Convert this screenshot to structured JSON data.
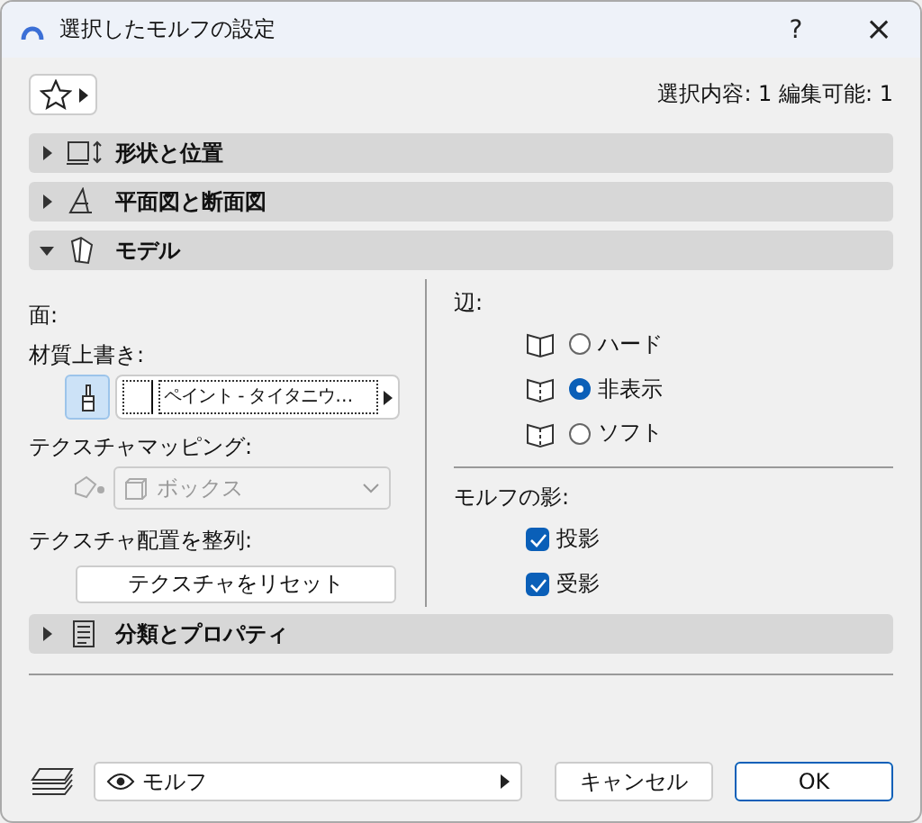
{
  "window": {
    "title": "選択したモルフの設定",
    "help": "?",
    "close": "×"
  },
  "selection_info": "選択内容: 1 編集可能: 1",
  "sections": [
    {
      "label": "形状と位置",
      "expanded": false,
      "kind": "shape"
    },
    {
      "label": "平面図と断面図",
      "expanded": false,
      "kind": "plan"
    },
    {
      "label": "モデル",
      "expanded": true,
      "kind": "model"
    }
  ],
  "model": {
    "face_label": "面:",
    "override_label": "材質上書き:",
    "override_on": true,
    "material": "ペイント - タイタニウ…",
    "mapping_label": "テクスチャマッピング:",
    "mapping": "ボックス",
    "mapping_disabled": true,
    "align_label": "テクスチャ配置を整列:",
    "reset_button": "テクスチャをリセット",
    "edges_label": "辺:",
    "edges": [
      {
        "label": "ハード",
        "selected": false
      },
      {
        "label": "非表示",
        "selected": true
      },
      {
        "label": "ソフト",
        "selected": false
      }
    ],
    "shadow_label": "モルフの影:",
    "shadows": [
      {
        "label": "投影",
        "checked": true
      },
      {
        "label": "受影",
        "checked": true
      }
    ]
  },
  "section_bottom": {
    "label": "分類とプロパティ",
    "expanded": false
  },
  "footer": {
    "layer": "モルフ",
    "cancel": "キャンセル",
    "ok": "OK"
  }
}
